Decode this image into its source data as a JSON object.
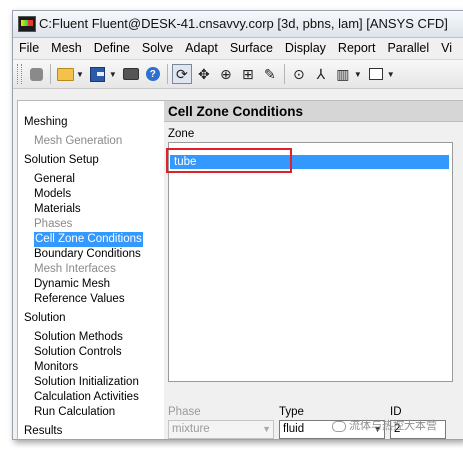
{
  "window": {
    "title": "C:Fluent Fluent@DESK-41.cnsavvy.corp  [3d, pbns, lam] [ANSYS CFD]"
  },
  "menubar": [
    "File",
    "Mesh",
    "Define",
    "Solve",
    "Adapt",
    "Surface",
    "Display",
    "Report",
    "Parallel",
    "Vi"
  ],
  "toolbar": {
    "icons": [
      "stop-icon",
      "open-folder-icon",
      "save-disk-icon",
      "camera-icon",
      "help-icon",
      "rotate-icon",
      "pan-icon",
      "zoom-in-icon",
      "zoom-box-icon",
      "probe-icon",
      "magnify-icon",
      "axes-icon",
      "columns-icon",
      "rectangle-icon"
    ]
  },
  "navigation": {
    "sections": [
      {
        "label": "Meshing",
        "items": [
          {
            "label": "Mesh Generation",
            "state": "disabled"
          }
        ]
      },
      {
        "label": "Solution Setup",
        "items": [
          {
            "label": "General",
            "state": "normal"
          },
          {
            "label": "Models",
            "state": "normal"
          },
          {
            "label": "Materials",
            "state": "normal"
          },
          {
            "label": "Phases",
            "state": "disabled"
          },
          {
            "label": "Cell Zone Conditions",
            "state": "selected"
          },
          {
            "label": "Boundary Conditions",
            "state": "normal"
          },
          {
            "label": "Mesh Interfaces",
            "state": "disabled"
          },
          {
            "label": "Dynamic Mesh",
            "state": "normal"
          },
          {
            "label": "Reference Values",
            "state": "normal"
          }
        ]
      },
      {
        "label": "Solution",
        "items": [
          {
            "label": "Solution Methods",
            "state": "normal"
          },
          {
            "label": "Solution Controls",
            "state": "normal"
          },
          {
            "label": "Monitors",
            "state": "normal"
          },
          {
            "label": "Solution Initialization",
            "state": "normal"
          },
          {
            "label": "Calculation Activities",
            "state": "normal"
          },
          {
            "label": "Run Calculation",
            "state": "normal"
          }
        ]
      },
      {
        "label": "Results",
        "items": []
      }
    ]
  },
  "panel": {
    "title": "Cell Zone Conditions",
    "zone_label": "Zone",
    "zones": [
      {
        "name": "tube",
        "selected": true
      }
    ],
    "phase_label": "Phase",
    "phase_value": "mixture",
    "type_label": "Type",
    "type_value": "fluid",
    "id_label": "ID",
    "id_value": "2"
  },
  "watermark": {
    "text": "流体与热控大本营"
  },
  "colors": {
    "selection": "#3399ff",
    "highlight_box": "#e0202a",
    "disabled_text": "#8a8a8a"
  }
}
